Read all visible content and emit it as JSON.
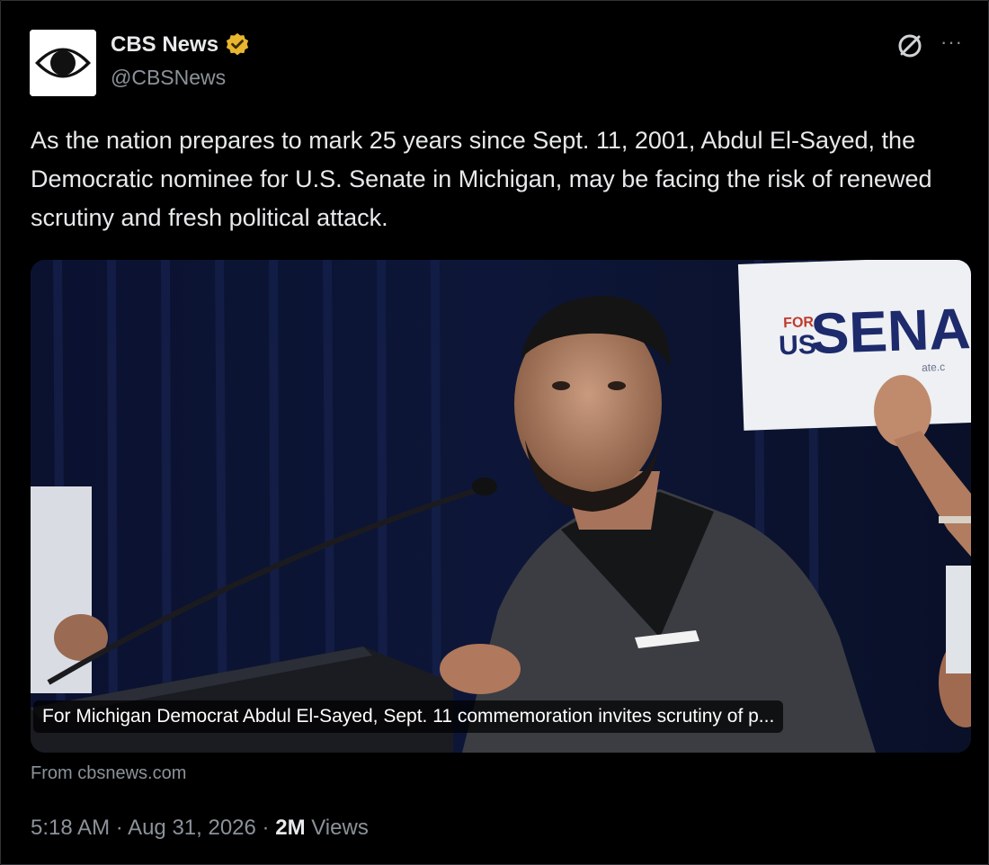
{
  "author": {
    "display_name": "CBS News",
    "handle": "@CBSNews",
    "verified_color": "#e8b62f"
  },
  "tweet": {
    "text": "As the nation prepares to mark 25 years since Sept. 11, 2001, Abdul El-Sayed, the Democratic nominee for U.S. Senate in Michigan, may be facing the risk of renewed scrutiny and fresh political attack."
  },
  "link_card": {
    "title": "For Michigan Democrat Abdul El-Sayed, Sept. 11 commemoration invites scrutiny of p...",
    "sign_text_top": "FOR",
    "sign_text_us": "US",
    "sign_text_main": "SENA",
    "sign_url": "ate.c"
  },
  "source": "From cbsnews.com",
  "meta": {
    "time": "5:18 AM",
    "separator": "·",
    "date": "Aug 31, 2026",
    "views_count": "2M",
    "views_label": "Views"
  },
  "icons": {
    "grok": "grok-icon",
    "more": "more-options-icon",
    "verified": "verified-badge-icon",
    "more_glyph": "···"
  }
}
